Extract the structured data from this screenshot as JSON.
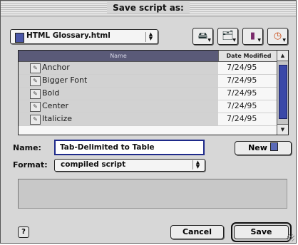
{
  "dialog": {
    "title": "Save script as:"
  },
  "location": {
    "folder_label": "HTML Glossary.html",
    "icon": "document-icon"
  },
  "toolbar": {
    "buttons": [
      {
        "name": "desktop-button",
        "icon": "desktop-icon"
      },
      {
        "name": "recent-folders-button",
        "icon": "folder-icon"
      },
      {
        "name": "favorites-button",
        "icon": "favorites-icon"
      },
      {
        "name": "recent-items-button",
        "icon": "clock-icon"
      }
    ]
  },
  "file_list": {
    "columns": {
      "name": "Name",
      "date": "Date Modified"
    },
    "rows": [
      {
        "name": "Anchor",
        "date": "7/24/95"
      },
      {
        "name": "Bigger Font",
        "date": "7/24/95"
      },
      {
        "name": "Bold",
        "date": "7/24/95"
      },
      {
        "name": "Center",
        "date": "7/24/95"
      },
      {
        "name": "Italicize",
        "date": "7/24/95"
      }
    ]
  },
  "form": {
    "name_label": "Name:",
    "name_value": "Tab-Delimited to Table",
    "new_button_label": "New",
    "format_label": "Format:",
    "format_value": "compiled script"
  },
  "buttons": {
    "help_label": "?",
    "cancel_label": "Cancel",
    "save_label": "Save"
  },
  "colors": {
    "accent": "#3a48a8",
    "focus_border": "#1e2a8a",
    "dialog_bg": "#d7d7d7"
  }
}
